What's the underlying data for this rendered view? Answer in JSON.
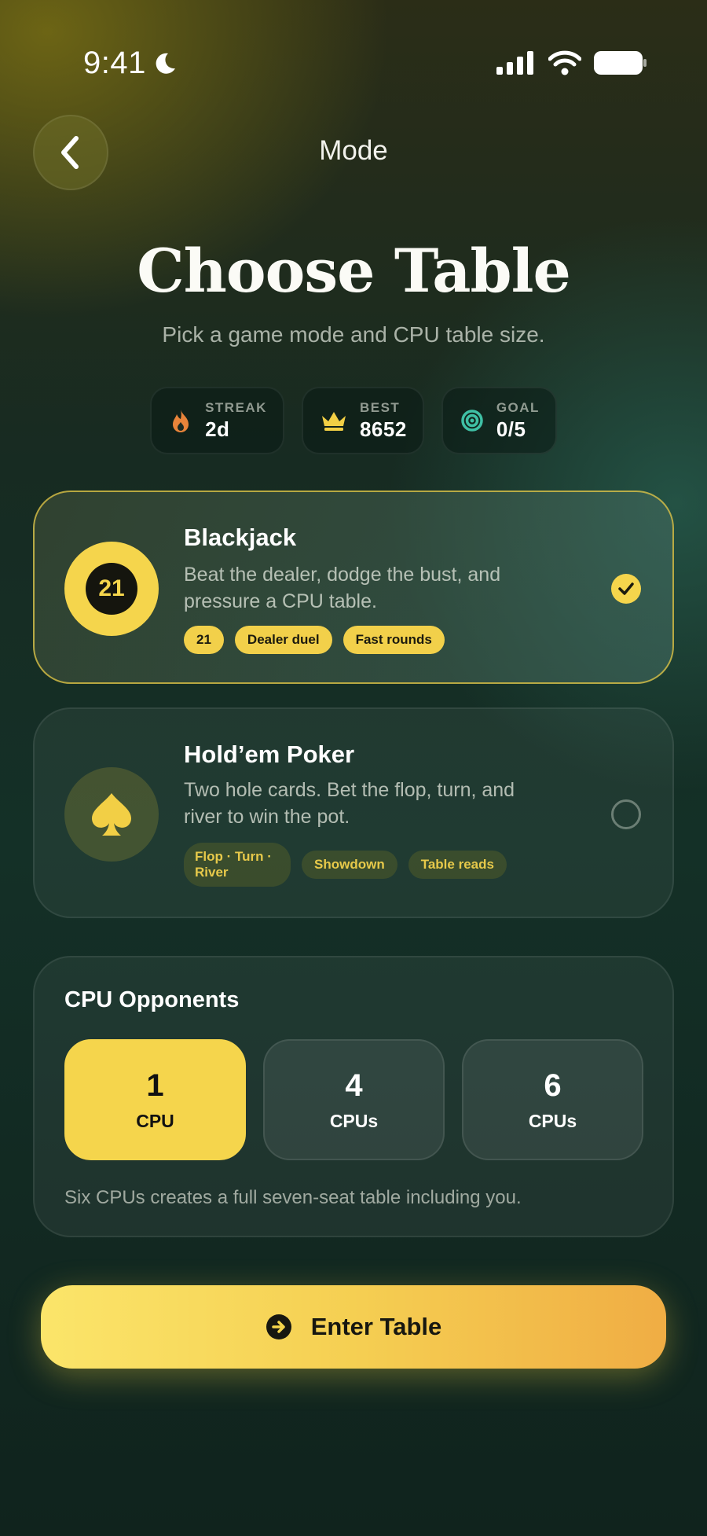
{
  "status_bar": {
    "time": "9:41"
  },
  "header": {
    "title": "Mode"
  },
  "page": {
    "title": "Choose Table",
    "subtitle": "Pick a game mode and CPU table size."
  },
  "stats": [
    {
      "label": "STREAK",
      "value": "2d",
      "icon": "flame-icon",
      "color": "#e8843a"
    },
    {
      "label": "BEST",
      "value": "8652",
      "icon": "crown-icon",
      "color": "#f2cf45"
    },
    {
      "label": "GOAL",
      "value": "0/5",
      "icon": "target-icon",
      "color": "#3fc0a5"
    }
  ],
  "modes": [
    {
      "name": "Blackjack",
      "description": "Beat the dealer, dodge the bust, and pressure a CPU table.",
      "icon_text": "21",
      "tags": [
        "21",
        "Dealer duel",
        "Fast rounds"
      ],
      "selected": true
    },
    {
      "name": "Hold’em Poker",
      "description": "Two hole cards. Bet the flop, turn, and river to win the pot.",
      "icon": "spade-icon",
      "tags": [
        "Flop · Turn · River",
        "Showdown",
        "Table reads"
      ],
      "selected": false
    }
  ],
  "cpu": {
    "title": "CPU Opponents",
    "options": [
      {
        "count": "1",
        "unit": "CPU",
        "active": true
      },
      {
        "count": "4",
        "unit": "CPUs",
        "active": false
      },
      {
        "count": "6",
        "unit": "CPUs",
        "active": false
      }
    ],
    "note": "Six CPUs creates a full seven-seat table including you."
  },
  "cta": {
    "label": "Enter Table"
  },
  "colors": {
    "accent": "#f5d54c",
    "background": "#143027"
  }
}
